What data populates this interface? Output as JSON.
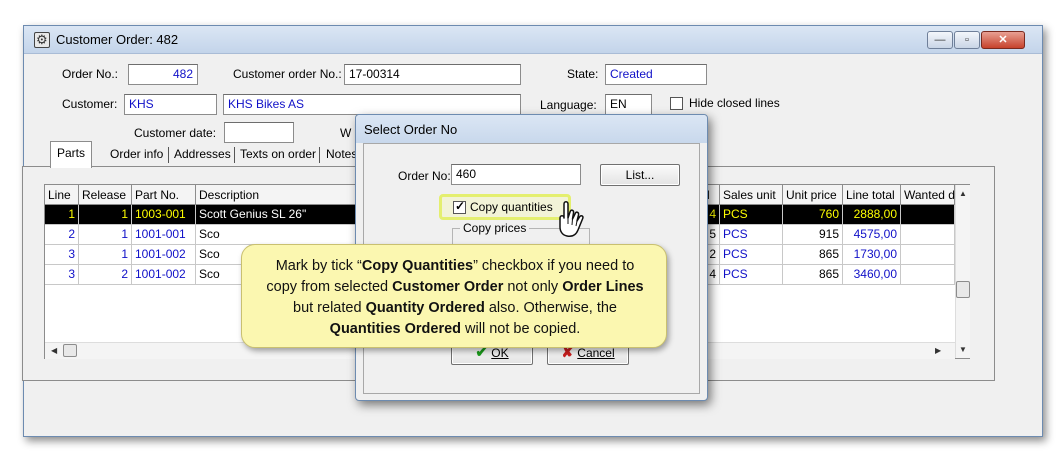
{
  "window": {
    "title": "Customer Order: 482",
    "controls": {
      "minimize": "—",
      "maximize": "▫",
      "close": "✕"
    }
  },
  "form": {
    "order_no_label": "Order No.:",
    "order_no": "482",
    "customer_order_no_label": "Customer order No.:",
    "customer_order_no": "17-00314",
    "state_label": "State:",
    "state": "Created",
    "customer_label": "Customer:",
    "customer_code": "KHS",
    "customer_name": "KHS Bikes AS",
    "language_label": "Language:",
    "language": "EN",
    "hide_closed_lines_label": "Hide closed lines",
    "hide_closed_lines_checked": false,
    "customer_date_label": "Customer date:",
    "customer_date": "",
    "partial_label": "W"
  },
  "tabs": [
    {
      "label": "Parts",
      "active": true
    },
    {
      "label": "Order info"
    },
    {
      "label": "Addresses"
    },
    {
      "label": "Texts on order"
    },
    {
      "label": "Notes"
    }
  ],
  "grid": {
    "columns": [
      "Line",
      "Release",
      "Part No.",
      "Description",
      "d",
      "Sales unit",
      "Unit price",
      "Line total",
      "Wanted deliv"
    ],
    "rows": [
      {
        "line": "1",
        "release": "1",
        "part_no": "1003-001",
        "description": "Scott Genius SL 26\"",
        "qty": "4",
        "unit": "PCS",
        "unit_price": "760",
        "line_total": "2888,00",
        "wanted": "",
        "selected": true
      },
      {
        "line": "2",
        "release": "1",
        "part_no": "1001-001",
        "description": "Sco",
        "qty": "5",
        "unit": "PCS",
        "unit_price": "915",
        "line_total": "4575,00",
        "wanted": ""
      },
      {
        "line": "3",
        "release": "1",
        "part_no": "1001-002",
        "description": "Sco",
        "qty": "2",
        "unit": "PCS",
        "unit_price": "865",
        "line_total": "1730,00",
        "wanted": ""
      },
      {
        "line": "3",
        "release": "2",
        "part_no": "1001-002",
        "description": "Sco",
        "qty": "4",
        "unit": "PCS",
        "unit_price": "865",
        "line_total": "3460,00",
        "wanted": ""
      }
    ]
  },
  "dialog": {
    "title": "Select Order No",
    "order_no_label": "Order No:",
    "order_no": "460",
    "list_button": "List...",
    "copy_quantities_label": "Copy quantities",
    "copy_quantities_checked": true,
    "copy_prices_label": "Copy prices",
    "ok_button": "OK",
    "cancel_button": "Cancel"
  },
  "callout": {
    "parts": [
      {
        "t": "Mark by tick “"
      },
      {
        "t": "Copy Quantities",
        "b": true
      },
      {
        "t": "” checkbox if you need to copy from selected "
      },
      {
        "t": "Customer Order",
        "b": true
      },
      {
        "t": " not only "
      },
      {
        "t": "Order Lines",
        "b": true
      },
      {
        "t": " but related "
      },
      {
        "t": "Quantity Ordered",
        "b": true
      },
      {
        "t": " also.  Otherwise, the "
      },
      {
        "t": "Quantities Ordered",
        "b": true
      },
      {
        "t": " will not be copied."
      }
    ]
  },
  "colors": {
    "accent_blue": "#1010c8",
    "selected_row_bg": "#000000",
    "selected_row_fg": "#ffff00",
    "callout_bg": "#fbf7b0",
    "ok_check": "#1a9a1a",
    "cancel_x": "#c81e1e"
  },
  "icons": {
    "app": "gear-icon",
    "ok": "check-icon",
    "cancel": "x-icon",
    "pointer": "hand-pointer-icon"
  }
}
